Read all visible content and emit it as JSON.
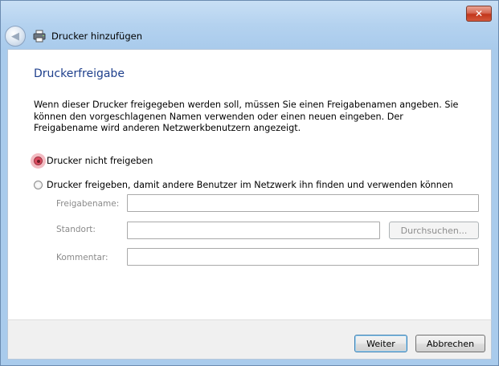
{
  "window": {
    "title": "Drucker hinzufügen",
    "close_glyph": "✕",
    "back_glyph": "◀"
  },
  "page": {
    "heading": "Druckerfreigabe",
    "description": "Wenn dieser Drucker freigegeben werden soll, müssen Sie einen Freigabenamen angeben. Sie können den vorgeschlagenen Namen verwenden oder einen neuen eingeben. Der Freigabename wird anderen Netzwerkbenutzern angezeigt."
  },
  "options": {
    "no_share_label": "Drucker nicht freigeben",
    "share_label": "Drucker freigeben, damit andere Benutzer im Netzwerk ihn finden und verwenden können",
    "selected": "no_share"
  },
  "fields": {
    "share_name_label": "Freigabename:",
    "share_name_value": "",
    "location_label": "Standort:",
    "location_value": "",
    "browse_label": "Durchsuchen...",
    "comment_label": "Kommentar:",
    "comment_value": ""
  },
  "footer": {
    "next_label": "Weiter",
    "cancel_label": "Abbrechen"
  },
  "icons": {
    "back": "back-arrow-icon",
    "printer": "printer-icon",
    "close": "close-icon"
  }
}
